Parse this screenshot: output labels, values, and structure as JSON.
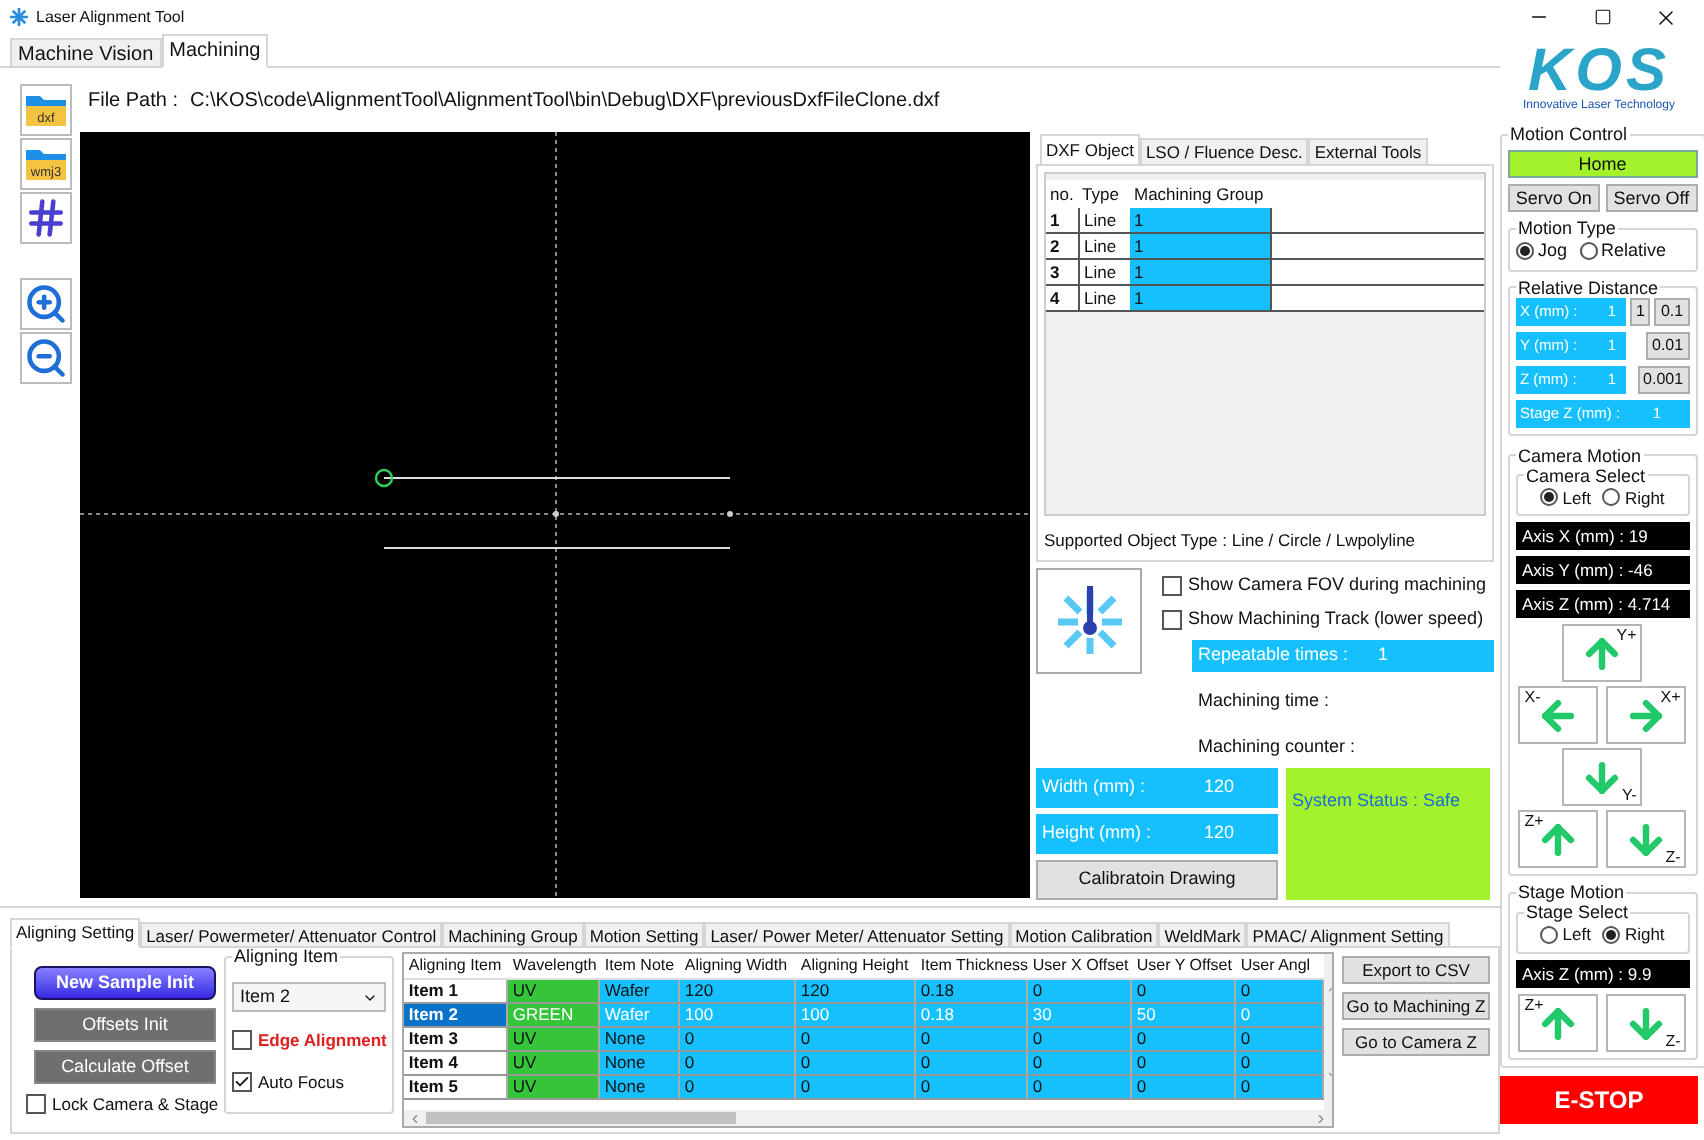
{
  "window": {
    "title": "Laser Alignment Tool"
  },
  "main_tabs": [
    {
      "label": "Machine Vision",
      "selected": false
    },
    {
      "label": "Machining",
      "selected": true
    }
  ],
  "logo": {
    "text": "KOS",
    "tagline": "Innovative Laser Technology"
  },
  "toolbar": [
    {
      "kind": "folder",
      "label": "dxf"
    },
    {
      "kind": "folder",
      "label": "wmj3"
    },
    {
      "kind": "grid"
    },
    {
      "kind": "zoom_in"
    },
    {
      "kind": "zoom_out"
    }
  ],
  "file_path": {
    "label": "File Path :",
    "value": "C:\\KOS\\code\\AlignmentTool\\AlignmentTool\\bin\\Debug\\DXF\\previousDxfFileClone.dxf"
  },
  "dxf_panel": {
    "tabs": [
      {
        "label": "DXF Object",
        "selected": true
      },
      {
        "label": "LSO / Fluence Desc.",
        "selected": false
      },
      {
        "label": "External Tools",
        "selected": false
      }
    ],
    "columns": [
      "no.",
      "Type",
      "Machining Group"
    ],
    "rows": [
      {
        "no": "1",
        "type": "Line",
        "group": "1"
      },
      {
        "no": "2",
        "type": "Line",
        "group": "1"
      },
      {
        "no": "3",
        "type": "Line",
        "group": "1"
      },
      {
        "no": "4",
        "type": "Line",
        "group": "1"
      }
    ],
    "supported": "Supported Object Type : Line / Circle / Lwpolyline"
  },
  "machining": {
    "checkboxes": [
      {
        "label": "Show Camera FOV during machining",
        "checked": false
      },
      {
        "label": "Show Machining Track (lower speed)",
        "checked": false
      }
    ],
    "repeatable": {
      "label": "Repeatable times :",
      "value": "1"
    },
    "time_label": "Machining time :",
    "counter_label": "Machining counter :",
    "width": {
      "label": "Width (mm) :",
      "value": "120"
    },
    "height": {
      "label": "Height (mm) :",
      "value": "120"
    },
    "calibration_button": "Calibratoin Drawing",
    "status": "System Status : Safe"
  },
  "motion_control": {
    "title": "Motion Control",
    "home": "Home",
    "servo_on": "Servo On",
    "servo_off": "Servo Off",
    "motion_type": {
      "title": "Motion Type",
      "options": [
        {
          "label": "Jog",
          "selected": true
        },
        {
          "label": "Relative",
          "selected": false
        }
      ]
    },
    "relative_distance": {
      "title": "Relative Distance",
      "rows": [
        {
          "label": "X (mm) :",
          "value": "1",
          "buttons": [
            "1",
            "0.1"
          ]
        },
        {
          "label": "Y (mm) :",
          "value": "1",
          "buttons": [
            "0.01"
          ]
        },
        {
          "label": "Z (mm) :",
          "value": "1",
          "buttons": [
            "0.001"
          ]
        },
        {
          "label": "Stage Z (mm) :",
          "value": "1"
        }
      ]
    }
  },
  "camera_motion": {
    "title": "Camera Motion",
    "select_title": "Camera Select",
    "options": [
      {
        "label": "Left",
        "selected": true
      },
      {
        "label": "Right",
        "selected": false
      }
    ],
    "axes": [
      "Axis X (mm) : 19",
      "Axis Y (mm) : -46",
      "Axis Z (mm) : 4.714"
    ],
    "jog": [
      "Y+",
      "X-",
      "X+",
      "Y-",
      "Z+",
      "Z-"
    ]
  },
  "stage_motion": {
    "title": "Stage Motion",
    "select_title": "Stage Select",
    "options": [
      {
        "label": "Left",
        "selected": false
      },
      {
        "label": "Right",
        "selected": true
      }
    ],
    "axes": [
      "Axis Z (mm) : 9.9"
    ],
    "jog": [
      "Z+",
      "Z-"
    ]
  },
  "estop": "E-STOP",
  "bottom_tabs": [
    {
      "label": "Aligning Setting",
      "selected": true
    },
    {
      "label": "Laser/ Powermeter/ Attenuator Control",
      "selected": false
    },
    {
      "label": "Machining Group",
      "selected": false
    },
    {
      "label": "Motion Setting",
      "selected": false
    },
    {
      "label": "Laser/ Power Meter/ Attenuator Setting",
      "selected": false
    },
    {
      "label": "Motion Calibration",
      "selected": false
    },
    {
      "label": "WeldMark",
      "selected": false
    },
    {
      "label": "PMAC/ Alignment Setting",
      "selected": false
    }
  ],
  "aligning": {
    "buttons": [
      {
        "label": "New Sample Init",
        "kind": "primary"
      },
      {
        "label": "Offsets Init",
        "kind": "secondary"
      },
      {
        "label": "Calculate Offset",
        "kind": "secondary"
      }
    ],
    "lock": {
      "label": "Lock Camera & Stage",
      "checked": false
    },
    "group_title": "Aligning Item",
    "select": "Item 2",
    "options": [
      {
        "label": "Edge Alignment",
        "checked": false,
        "kind": "warning"
      },
      {
        "label": "Auto Focus",
        "checked": true,
        "kind": "normal"
      }
    ]
  },
  "items_table": {
    "columns": [
      "Aligning Item",
      "Wavelength",
      "Item Note",
      "Aligning Width",
      "Aligning Height",
      "Item Thickness",
      "User X Offset",
      "User Y Offset",
      "User Angl"
    ],
    "rows": [
      {
        "selected": false,
        "cells": [
          "Item 1",
          "UV",
          "Wafer",
          "120",
          "120",
          "0.18",
          "0",
          "0",
          "0"
        ]
      },
      {
        "selected": true,
        "cells": [
          "Item 2",
          "GREEN",
          "Wafer",
          "100",
          "100",
          "0.18",
          "30",
          "50",
          "0"
        ]
      },
      {
        "selected": false,
        "cells": [
          "Item 3",
          "UV",
          "None",
          "0",
          "0",
          "0",
          "0",
          "0",
          "0"
        ]
      },
      {
        "selected": false,
        "cells": [
          "Item 4",
          "UV",
          "None",
          "0",
          "0",
          "0",
          "0",
          "0",
          "0"
        ]
      },
      {
        "selected": false,
        "cells": [
          "Item 5",
          "UV",
          "None",
          "0",
          "0",
          "0",
          "0",
          "0",
          "0"
        ]
      }
    ]
  },
  "side_buttons": [
    "Export to CSV",
    "Go to Machining Z",
    "Go to Camera Z"
  ]
}
